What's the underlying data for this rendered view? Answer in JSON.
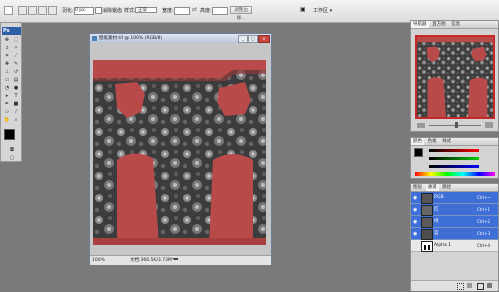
{
  "options_bar": {
    "feather_label": "羽化:",
    "feather_value": "0 px",
    "antialias_label": "消除锯齿",
    "style_label": "样式:",
    "style_value": "正常",
    "width_label": "宽度:",
    "height_label": "高度:",
    "refine_edge_label": "调整边缘...",
    "workspace_label": "工作区 ▾"
  },
  "toolbox": {
    "logo": "Ps"
  },
  "document": {
    "title": "壁纸素材.tif @ 100% (RGB/8)",
    "zoom": "100%",
    "status": "文档:366.5K/3.73M"
  },
  "navigator": {
    "tabs": [
      "导航器",
      "直方图",
      "信息"
    ]
  },
  "channels_mini": {
    "tabs": [
      "颜色",
      "色板",
      "样式"
    ]
  },
  "channels": {
    "tabs": [
      "图层",
      "通道",
      "路径"
    ],
    "rows": [
      {
        "name": "RGB",
        "shortcut": "Ctrl+~"
      },
      {
        "name": "红",
        "shortcut": "Ctrl+1"
      },
      {
        "name": "绿",
        "shortcut": "Ctrl+2"
      },
      {
        "name": "蓝",
        "shortcut": "Ctrl+3"
      },
      {
        "name": "Alpha 1",
        "shortcut": "Ctrl+4"
      }
    ]
  },
  "colors": {
    "canvas_bg": "#3e3e3e",
    "shape_red": "#b84a4a",
    "selected_row": "#3d6fd6"
  }
}
